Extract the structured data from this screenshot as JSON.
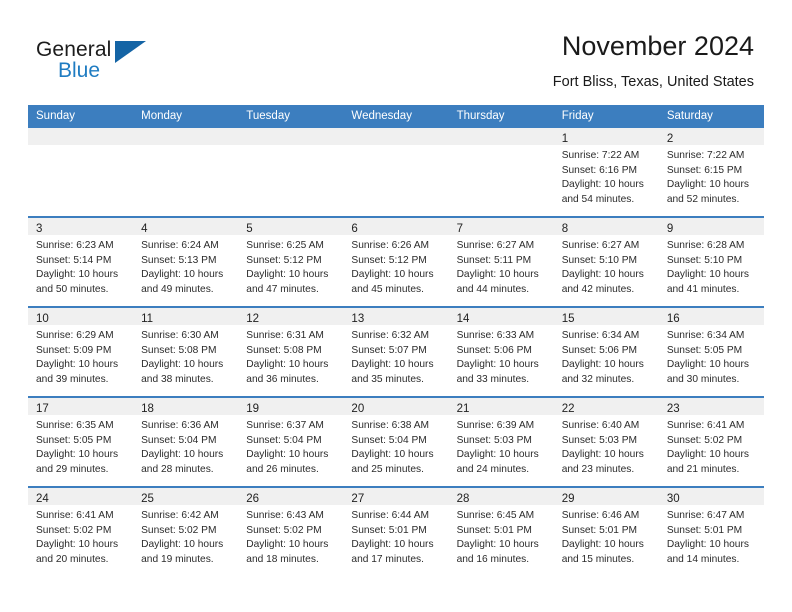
{
  "logo": {
    "word_one": "General",
    "word_two": "Blue",
    "flag_icon": "triangle-flag-icon",
    "brand_blue": "#1f7cc2",
    "flag_blue": "#1464a5"
  },
  "header": {
    "month_title": "November 2024",
    "location": "Fort Bliss, Texas, United States"
  },
  "calendar": {
    "header_bg": "#3c7ebf",
    "daynum_bg": "#f0f0f0",
    "weekday_headers": [
      "Sunday",
      "Monday",
      "Tuesday",
      "Wednesday",
      "Thursday",
      "Friday",
      "Saturday"
    ],
    "weeks": [
      [
        {
          "day": "",
          "sunrise": "",
          "sunset": "",
          "daylight_1": "",
          "daylight_2": ""
        },
        {
          "day": "",
          "sunrise": "",
          "sunset": "",
          "daylight_1": "",
          "daylight_2": ""
        },
        {
          "day": "",
          "sunrise": "",
          "sunset": "",
          "daylight_1": "",
          "daylight_2": ""
        },
        {
          "day": "",
          "sunrise": "",
          "sunset": "",
          "daylight_1": "",
          "daylight_2": ""
        },
        {
          "day": "",
          "sunrise": "",
          "sunset": "",
          "daylight_1": "",
          "daylight_2": ""
        },
        {
          "day": "1",
          "sunrise": "Sunrise: 7:22 AM",
          "sunset": "Sunset: 6:16 PM",
          "daylight_1": "Daylight: 10 hours",
          "daylight_2": "and 54 minutes."
        },
        {
          "day": "2",
          "sunrise": "Sunrise: 7:22 AM",
          "sunset": "Sunset: 6:15 PM",
          "daylight_1": "Daylight: 10 hours",
          "daylight_2": "and 52 minutes."
        }
      ],
      [
        {
          "day": "3",
          "sunrise": "Sunrise: 6:23 AM",
          "sunset": "Sunset: 5:14 PM",
          "daylight_1": "Daylight: 10 hours",
          "daylight_2": "and 50 minutes."
        },
        {
          "day": "4",
          "sunrise": "Sunrise: 6:24 AM",
          "sunset": "Sunset: 5:13 PM",
          "daylight_1": "Daylight: 10 hours",
          "daylight_2": "and 49 minutes."
        },
        {
          "day": "5",
          "sunrise": "Sunrise: 6:25 AM",
          "sunset": "Sunset: 5:12 PM",
          "daylight_1": "Daylight: 10 hours",
          "daylight_2": "and 47 minutes."
        },
        {
          "day": "6",
          "sunrise": "Sunrise: 6:26 AM",
          "sunset": "Sunset: 5:12 PM",
          "daylight_1": "Daylight: 10 hours",
          "daylight_2": "and 45 minutes."
        },
        {
          "day": "7",
          "sunrise": "Sunrise: 6:27 AM",
          "sunset": "Sunset: 5:11 PM",
          "daylight_1": "Daylight: 10 hours",
          "daylight_2": "and 44 minutes."
        },
        {
          "day": "8",
          "sunrise": "Sunrise: 6:27 AM",
          "sunset": "Sunset: 5:10 PM",
          "daylight_1": "Daylight: 10 hours",
          "daylight_2": "and 42 minutes."
        },
        {
          "day": "9",
          "sunrise": "Sunrise: 6:28 AM",
          "sunset": "Sunset: 5:10 PM",
          "daylight_1": "Daylight: 10 hours",
          "daylight_2": "and 41 minutes."
        }
      ],
      [
        {
          "day": "10",
          "sunrise": "Sunrise: 6:29 AM",
          "sunset": "Sunset: 5:09 PM",
          "daylight_1": "Daylight: 10 hours",
          "daylight_2": "and 39 minutes."
        },
        {
          "day": "11",
          "sunrise": "Sunrise: 6:30 AM",
          "sunset": "Sunset: 5:08 PM",
          "daylight_1": "Daylight: 10 hours",
          "daylight_2": "and 38 minutes."
        },
        {
          "day": "12",
          "sunrise": "Sunrise: 6:31 AM",
          "sunset": "Sunset: 5:08 PM",
          "daylight_1": "Daylight: 10 hours",
          "daylight_2": "and 36 minutes."
        },
        {
          "day": "13",
          "sunrise": "Sunrise: 6:32 AM",
          "sunset": "Sunset: 5:07 PM",
          "daylight_1": "Daylight: 10 hours",
          "daylight_2": "and 35 minutes."
        },
        {
          "day": "14",
          "sunrise": "Sunrise: 6:33 AM",
          "sunset": "Sunset: 5:06 PM",
          "daylight_1": "Daylight: 10 hours",
          "daylight_2": "and 33 minutes."
        },
        {
          "day": "15",
          "sunrise": "Sunrise: 6:34 AM",
          "sunset": "Sunset: 5:06 PM",
          "daylight_1": "Daylight: 10 hours",
          "daylight_2": "and 32 minutes."
        },
        {
          "day": "16",
          "sunrise": "Sunrise: 6:34 AM",
          "sunset": "Sunset: 5:05 PM",
          "daylight_1": "Daylight: 10 hours",
          "daylight_2": "and 30 minutes."
        }
      ],
      [
        {
          "day": "17",
          "sunrise": "Sunrise: 6:35 AM",
          "sunset": "Sunset: 5:05 PM",
          "daylight_1": "Daylight: 10 hours",
          "daylight_2": "and 29 minutes."
        },
        {
          "day": "18",
          "sunrise": "Sunrise: 6:36 AM",
          "sunset": "Sunset: 5:04 PM",
          "daylight_1": "Daylight: 10 hours",
          "daylight_2": "and 28 minutes."
        },
        {
          "day": "19",
          "sunrise": "Sunrise: 6:37 AM",
          "sunset": "Sunset: 5:04 PM",
          "daylight_1": "Daylight: 10 hours",
          "daylight_2": "and 26 minutes."
        },
        {
          "day": "20",
          "sunrise": "Sunrise: 6:38 AM",
          "sunset": "Sunset: 5:04 PM",
          "daylight_1": "Daylight: 10 hours",
          "daylight_2": "and 25 minutes."
        },
        {
          "day": "21",
          "sunrise": "Sunrise: 6:39 AM",
          "sunset": "Sunset: 5:03 PM",
          "daylight_1": "Daylight: 10 hours",
          "daylight_2": "and 24 minutes."
        },
        {
          "day": "22",
          "sunrise": "Sunrise: 6:40 AM",
          "sunset": "Sunset: 5:03 PM",
          "daylight_1": "Daylight: 10 hours",
          "daylight_2": "and 23 minutes."
        },
        {
          "day": "23",
          "sunrise": "Sunrise: 6:41 AM",
          "sunset": "Sunset: 5:02 PM",
          "daylight_1": "Daylight: 10 hours",
          "daylight_2": "and 21 minutes."
        }
      ],
      [
        {
          "day": "24",
          "sunrise": "Sunrise: 6:41 AM",
          "sunset": "Sunset: 5:02 PM",
          "daylight_1": "Daylight: 10 hours",
          "daylight_2": "and 20 minutes."
        },
        {
          "day": "25",
          "sunrise": "Sunrise: 6:42 AM",
          "sunset": "Sunset: 5:02 PM",
          "daylight_1": "Daylight: 10 hours",
          "daylight_2": "and 19 minutes."
        },
        {
          "day": "26",
          "sunrise": "Sunrise: 6:43 AM",
          "sunset": "Sunset: 5:02 PM",
          "daylight_1": "Daylight: 10 hours",
          "daylight_2": "and 18 minutes."
        },
        {
          "day": "27",
          "sunrise": "Sunrise: 6:44 AM",
          "sunset": "Sunset: 5:01 PM",
          "daylight_1": "Daylight: 10 hours",
          "daylight_2": "and 17 minutes."
        },
        {
          "day": "28",
          "sunrise": "Sunrise: 6:45 AM",
          "sunset": "Sunset: 5:01 PM",
          "daylight_1": "Daylight: 10 hours",
          "daylight_2": "and 16 minutes."
        },
        {
          "day": "29",
          "sunrise": "Sunrise: 6:46 AM",
          "sunset": "Sunset: 5:01 PM",
          "daylight_1": "Daylight: 10 hours",
          "daylight_2": "and 15 minutes."
        },
        {
          "day": "30",
          "sunrise": "Sunrise: 6:47 AM",
          "sunset": "Sunset: 5:01 PM",
          "daylight_1": "Daylight: 10 hours",
          "daylight_2": "and 14 minutes."
        }
      ]
    ]
  }
}
